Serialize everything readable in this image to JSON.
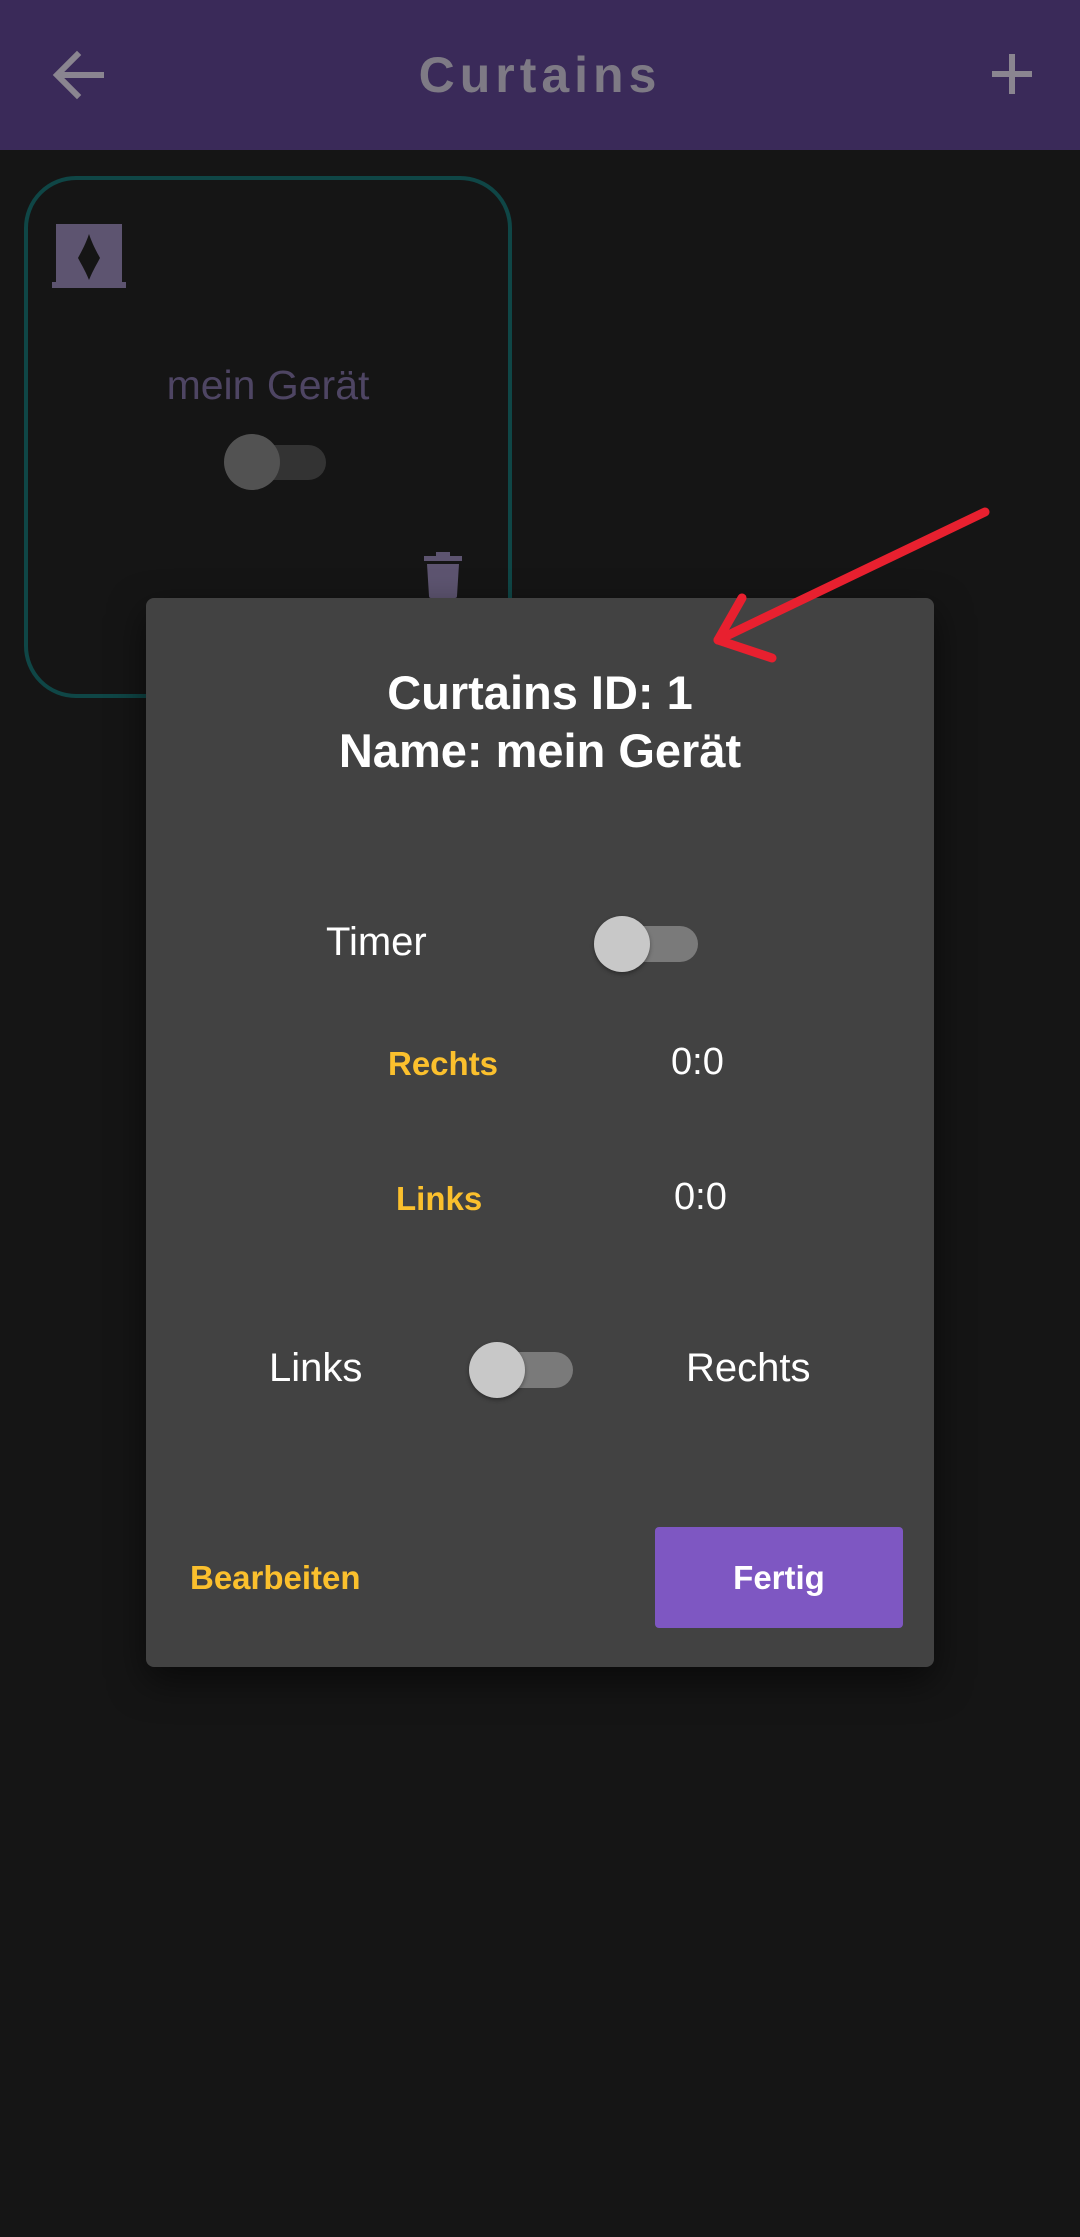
{
  "app_bar": {
    "title": "Curtains",
    "back_icon": "arrow-left-icon",
    "add_icon": "plus-icon"
  },
  "device_card": {
    "name": "mein Gerät",
    "icon": "curtain-icon",
    "toggle_on": false,
    "delete_icon": "trash-icon"
  },
  "dialog": {
    "title_line1": "Curtains ID: 1",
    "title_line2": "Name: mein Gerät",
    "timer": {
      "label": "Timer",
      "on": false
    },
    "rechts": {
      "label": "Rechts",
      "value": "0:0"
    },
    "links": {
      "label": "Links",
      "value": "0:0"
    },
    "direction": {
      "left_label": "Links",
      "right_label": "Rechts",
      "on": false
    },
    "edit_button": "Bearbeiten",
    "done_button": "Fertig"
  },
  "colors": {
    "app_bar": "#3a2a59",
    "background": "#151515",
    "dialog": "#424242",
    "accent_amber": "#fbc02d",
    "primary_button": "#7e57c2",
    "card_border": "#0f4646",
    "annotation_arrow": "#e8202f"
  }
}
